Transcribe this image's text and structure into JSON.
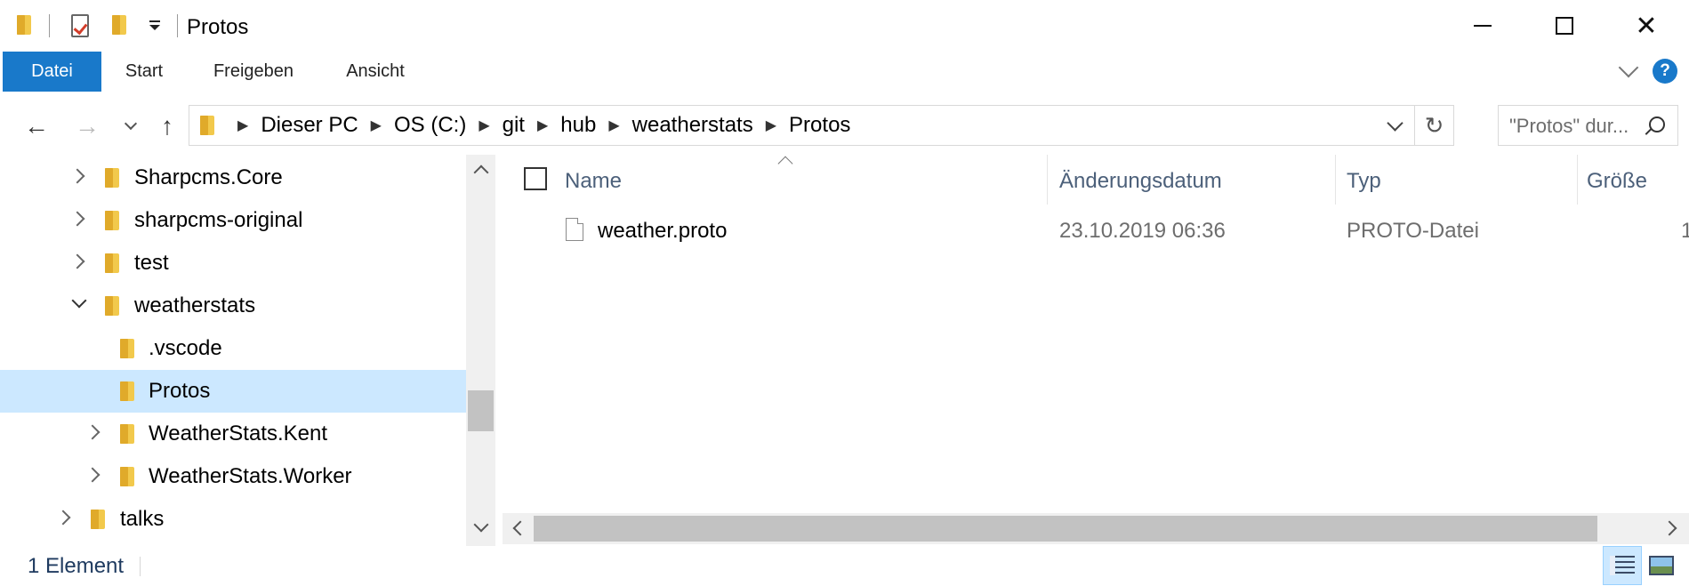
{
  "window": {
    "title": "Protos",
    "minimize_icon": "minimize-icon",
    "maximize_icon": "maximize-icon",
    "close_icon": "close-icon"
  },
  "ribbon": {
    "tabs": [
      {
        "label": "Datei",
        "active": true
      },
      {
        "label": "Start"
      },
      {
        "label": "Freigeben"
      },
      {
        "label": "Ansicht"
      }
    ],
    "help": "?"
  },
  "address": {
    "crumbs": [
      "Dieser PC",
      "OS (C:)",
      "git",
      "hub",
      "weatherstats",
      "Protos"
    ],
    "search_placeholder": "\"Protos\" dur..."
  },
  "tree": [
    {
      "label": "Sharpcms.Core",
      "state": "collapsed"
    },
    {
      "label": "sharpcms-original",
      "state": "collapsed"
    },
    {
      "label": "test",
      "state": "collapsed"
    },
    {
      "label": "weatherstats",
      "state": "expanded"
    },
    {
      "label": ".vscode",
      "state": "none"
    },
    {
      "label": "Protos",
      "state": "none",
      "selected": true
    },
    {
      "label": "WeatherStats.Kent",
      "state": "collapsed"
    },
    {
      "label": "WeatherStats.Worker",
      "state": "collapsed"
    },
    {
      "label": "talks",
      "state": "collapsed"
    }
  ],
  "columns": {
    "name": "Name",
    "modified": "Änderungsdatum",
    "type": "Typ",
    "size": "Größe"
  },
  "files": [
    {
      "name": "weather.proto",
      "modified": "23.10.2019 06:36",
      "type": "PROTO-Datei",
      "size": "1"
    }
  ],
  "status": {
    "count": "1 Element"
  },
  "colors": {
    "accent": "#1979ca",
    "selection": "#cce8ff",
    "header_text": "#4c607a"
  }
}
